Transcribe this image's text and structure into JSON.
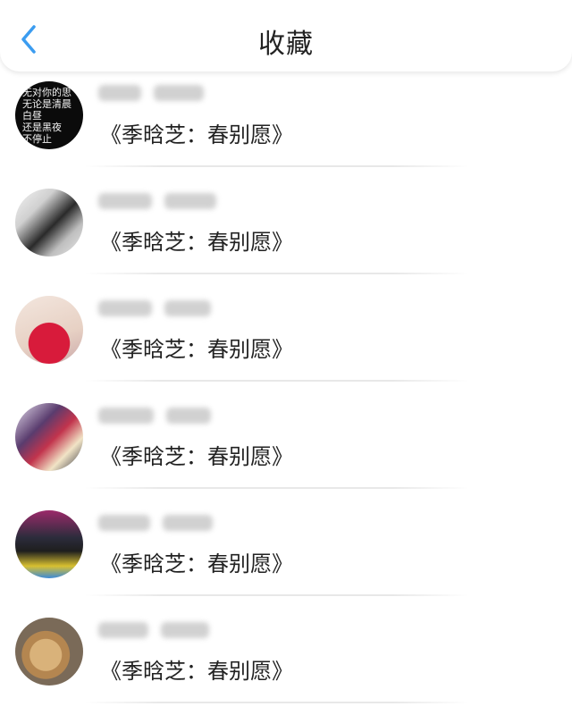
{
  "header": {
    "title": "收藏"
  },
  "icons": {
    "back": "chevron-left-icon"
  },
  "colors": {
    "accent": "#3b9cf0",
    "text": "#222222",
    "divider": "#e8e8e8"
  },
  "favorites": [
    {
      "song": "《季晗芝：春别愿》",
      "avatar_text": "无对你的思\n无论是清晨\n白昼\n还是黑夜\n不停止"
    },
    {
      "song": "《季晗芝：春别愿》"
    },
    {
      "song": "《季晗芝：春别愿》"
    },
    {
      "song": "《季晗芝：春别愿》"
    },
    {
      "song": "《季晗芝：春别愿》"
    },
    {
      "song": "《季晗芝：春别愿》"
    }
  ]
}
